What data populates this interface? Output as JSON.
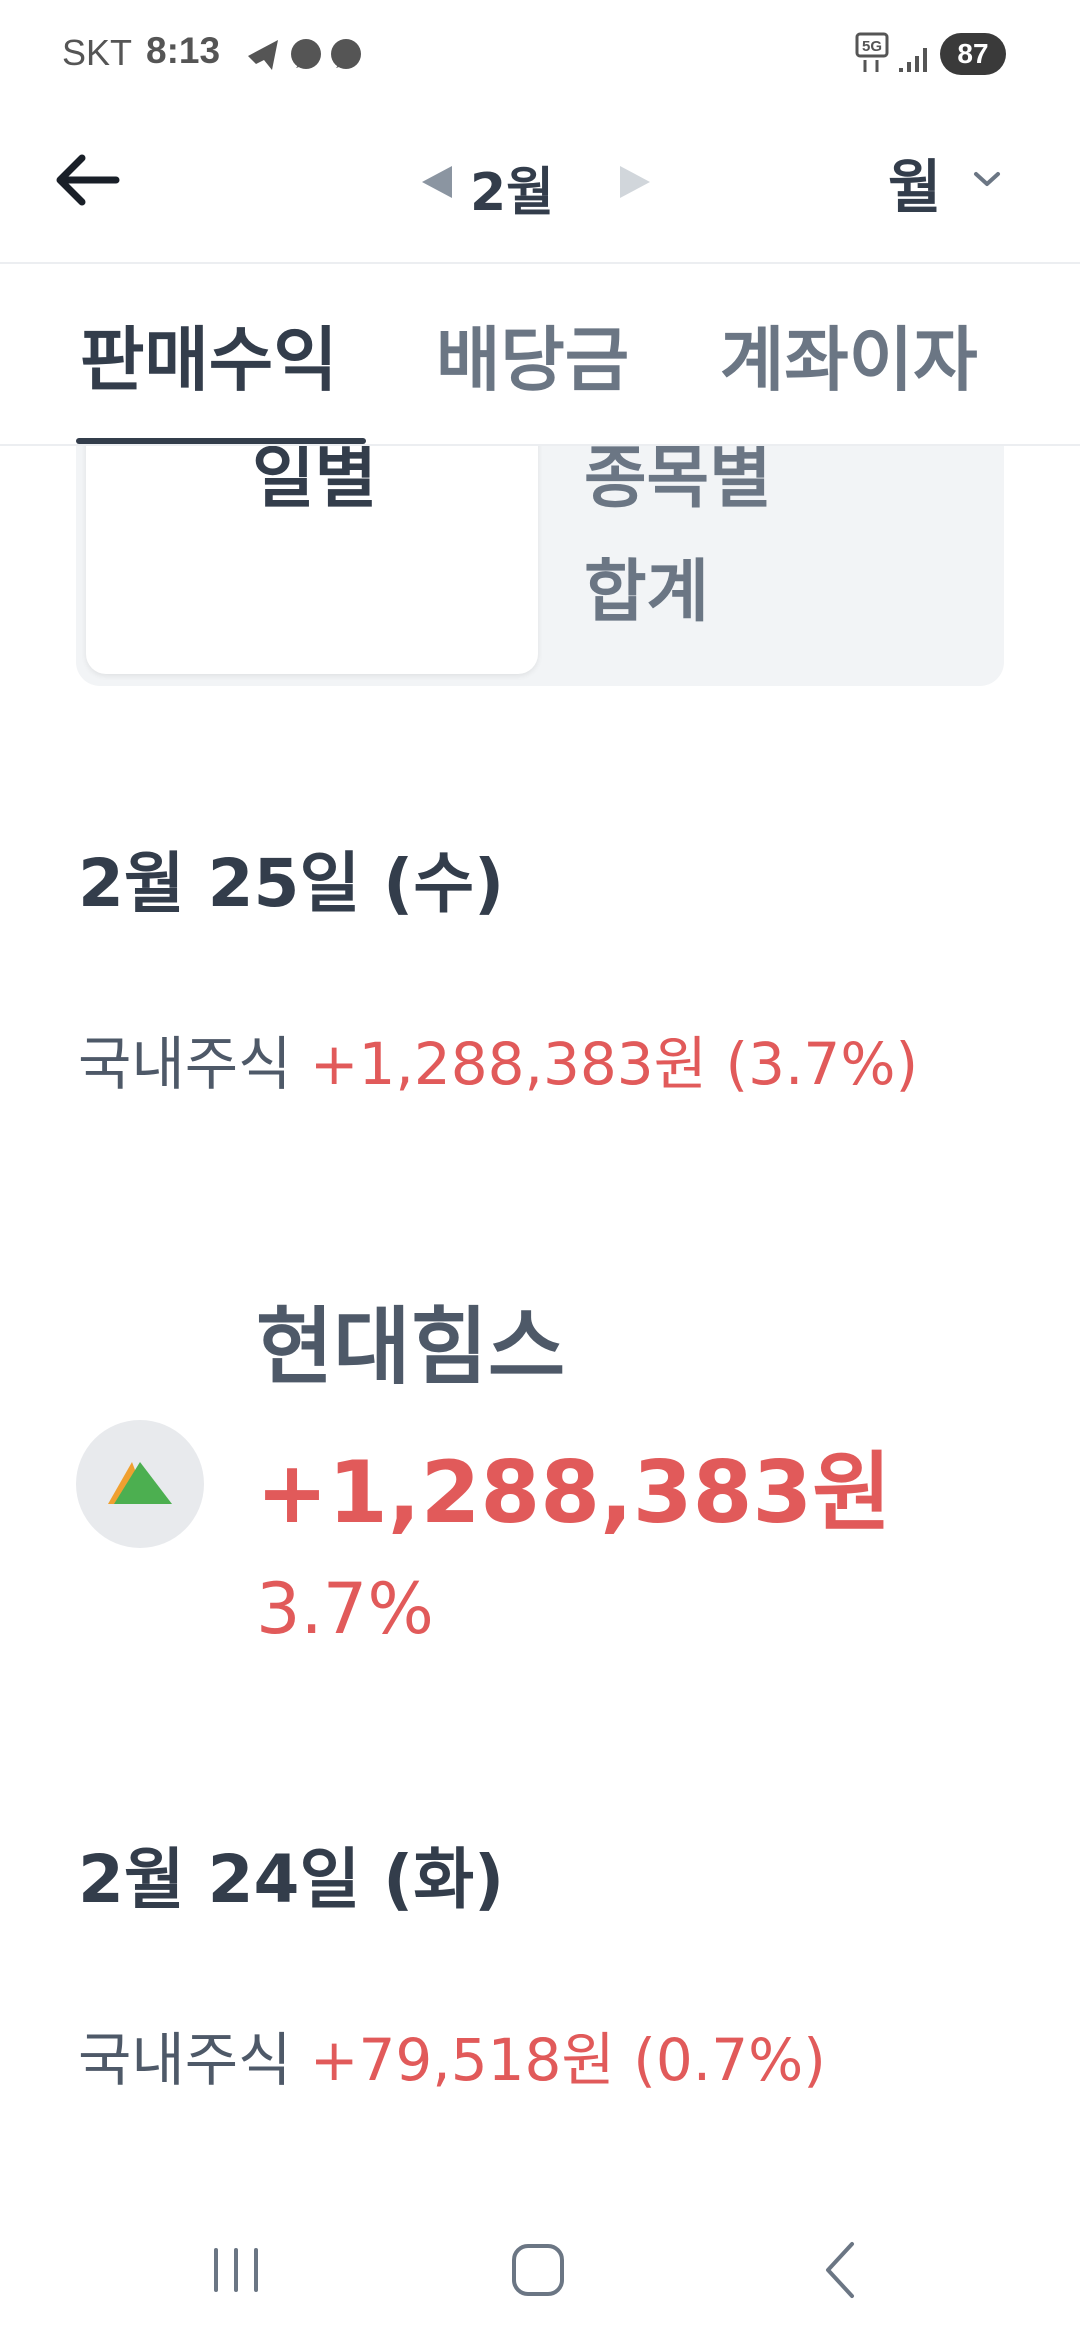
{
  "status_bar": {
    "carrier": "SKT",
    "time": "8:13",
    "battery": "87",
    "network": "5G"
  },
  "header": {
    "month": "2월",
    "period": "월"
  },
  "tabs": [
    {
      "label": "판매수익",
      "active": true
    },
    {
      "label": "배당금",
      "active": false
    },
    {
      "label": "계좌이자",
      "active": false
    }
  ],
  "segment": {
    "daily": "일별",
    "by_stock_line1": "종목별",
    "by_stock_line2": "합계"
  },
  "days": [
    {
      "date": "2월 25일 (수)",
      "category": "국내주식",
      "amount": "+1,288,383원 (3.7%)",
      "stocks": [
        {
          "name": "현대힘스",
          "profit": "+1,288,383원",
          "rate": "3.7%"
        }
      ]
    },
    {
      "date": "2월 24일 (화)",
      "category": "국내주식",
      "amount": "+79,518원 (0.7%)"
    }
  ],
  "colors": {
    "profit_red": "#e15a5a",
    "text_dark": "#333d4b",
    "text_gray": "#6b7684",
    "logo_green": "#4caf50",
    "logo_orange": "#f0a030"
  }
}
